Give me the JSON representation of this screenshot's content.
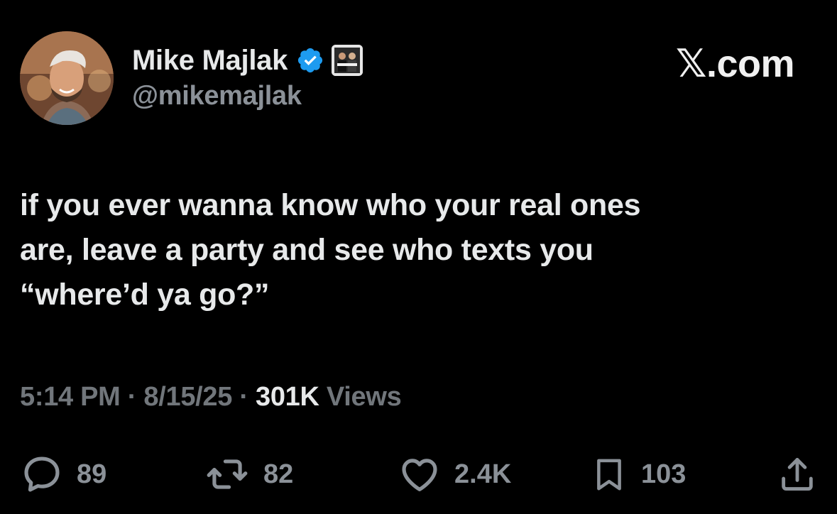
{
  "author": {
    "display_name": "Mike Majlak",
    "handle": "@mikemajlak",
    "verified": true
  },
  "site_mark": "𝕏.com",
  "tweet": {
    "lines": [
      "if you ever wanna know who your real ones",
      "are, leave a party and see who texts you",
      "“where’d ya go?”"
    ]
  },
  "meta": {
    "time": "5:14 PM",
    "separator": "·",
    "date": "8/15/25",
    "views_count": "301K",
    "views_label": "Views"
  },
  "actions": {
    "replies": "89",
    "reposts": "82",
    "likes": "2.4K",
    "bookmarks": "103"
  },
  "icons": {
    "reply": "speech-bubble-icon",
    "repost": "repost-arrows-icon",
    "like": "heart-icon",
    "bookmark": "bookmark-icon",
    "share": "share-upload-icon",
    "verified": "verified-badge-icon"
  },
  "colors": {
    "background": "#000000",
    "primary_text": "#e7e9ea",
    "secondary_text": "#71767b",
    "verified_blue": "#1d9bf0"
  }
}
